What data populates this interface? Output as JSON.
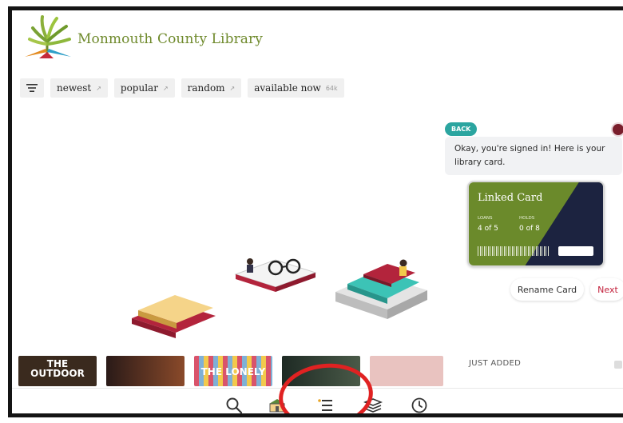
{
  "header": {
    "brand": "Monmouth County Library",
    "logo_icon": "tree-logo-icon",
    "colors": {
      "brand_text": "#6f8a2c"
    }
  },
  "filters": {
    "menu_icon": "filter-lines-icon",
    "chips": [
      {
        "label": "newest",
        "count": ""
      },
      {
        "label": "popular",
        "count": ""
      },
      {
        "label": "random",
        "count": ""
      },
      {
        "label": "available now",
        "count": "64k"
      }
    ]
  },
  "chat": {
    "back_label": "BACK",
    "message": "Okay, you're signed in! Here is your library card."
  },
  "card": {
    "title": "Linked Card",
    "loans_label": "LOANS",
    "loans_value": "4 of 5",
    "holds_label": "HOLDS",
    "holds_value": "0 of 8",
    "colors": {
      "green": "#6b8a2b",
      "navy": "#1c2340"
    }
  },
  "actions": {
    "rename": "Rename Card",
    "next": "Next",
    "colors": {
      "next": "#c21f3a"
    }
  },
  "just_added": {
    "label": "JUST ADDED",
    "books": [
      {
        "text": "THE OUTDOOR",
        "color": "#3a2a1e"
      },
      {
        "text": "",
        "color": "#5a2a20"
      },
      {
        "text": "THE LONELY",
        "color": "#c87a9a"
      },
      {
        "text": "",
        "color": "#26322a"
      },
      {
        "text": "",
        "color": "#e9c3c0"
      }
    ]
  },
  "nav": {
    "items": [
      "search-icon",
      "library-building-icon",
      "list-icon",
      "shelf-stack-icon",
      "clock-icon"
    ]
  },
  "annotation": {
    "color": "#e02222"
  }
}
